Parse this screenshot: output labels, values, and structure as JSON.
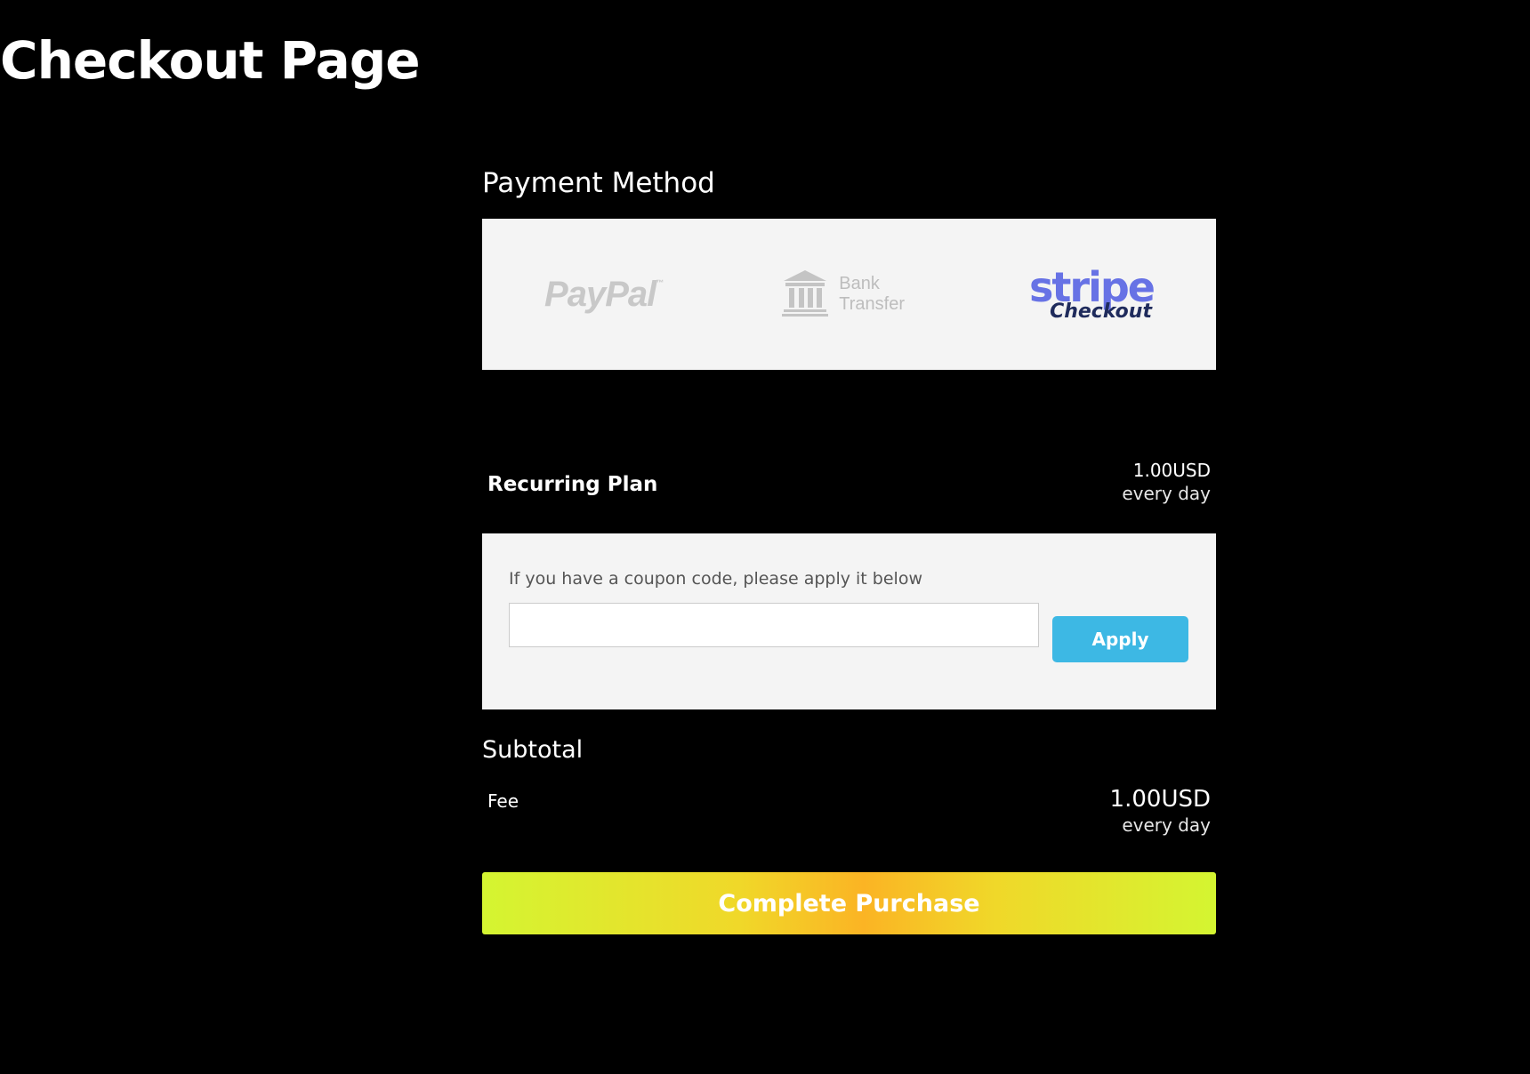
{
  "page": {
    "title": "Checkout Page"
  },
  "payment": {
    "heading": "Payment Method",
    "methods": [
      {
        "name": "PayPal",
        "logo_text": "PayPal",
        "trademark": "™",
        "selected": false,
        "color": "#c8c8c8"
      },
      {
        "name": "Bank Transfer",
        "line1": "Bank",
        "line2": "Transfer",
        "icon": "bank-icon",
        "selected": false,
        "color": "#bdbdbd"
      },
      {
        "name": "Stripe Checkout",
        "line1": "stripe",
        "line2": "Checkout",
        "selected": true,
        "color": "#6772e5"
      }
    ]
  },
  "plan": {
    "name": "Recurring Plan",
    "amount": "1.00USD",
    "period": "every day"
  },
  "coupon": {
    "label": "If you have a coupon code, please apply it below",
    "value": "",
    "placeholder": "",
    "apply_label": "Apply",
    "apply_color": "#3db8e4"
  },
  "subtotal": {
    "heading": "Subtotal",
    "fee_label": "Fee",
    "amount": "1.00USD",
    "period": "every day"
  },
  "actions": {
    "complete_label": "Complete Purchase"
  },
  "colors": {
    "background": "#000000",
    "panel": "#f4f4f4",
    "gradient_edge": "#d4f531",
    "gradient_center": "#fbb424"
  }
}
